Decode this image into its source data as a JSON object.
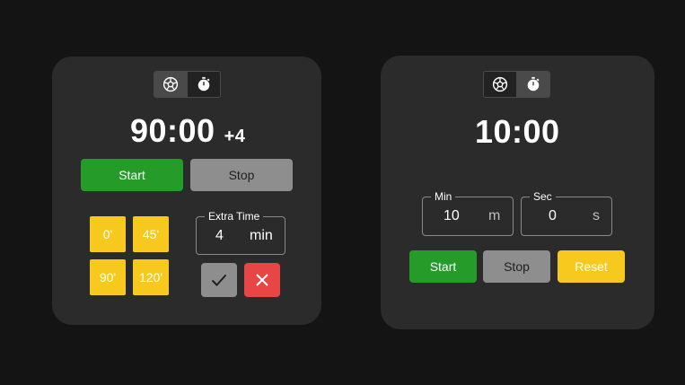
{
  "match": {
    "modes": [
      {
        "icon": "soccer-ball-icon",
        "active": true
      },
      {
        "icon": "stopwatch-icon",
        "active": false
      }
    ],
    "clock": "90:00",
    "added_time": "+4",
    "start_label": "Start",
    "stop_label": "Stop",
    "quick_minutes": [
      "0'",
      "45'",
      "90'",
      "120'"
    ],
    "extra_time": {
      "legend": "Extra Time",
      "value": "4",
      "unit": "min"
    }
  },
  "timer": {
    "modes": [
      {
        "icon": "soccer-ball-icon",
        "active": false
      },
      {
        "icon": "stopwatch-icon",
        "active": true
      }
    ],
    "clock": "10:00",
    "min_field": {
      "legend": "Min",
      "value": "10",
      "unit": "m"
    },
    "sec_field": {
      "legend": "Sec",
      "value": "0",
      "unit": "s"
    },
    "start_label": "Start",
    "stop_label": "Stop",
    "reset_label": "Reset"
  },
  "colors": {
    "green": "#259b2a",
    "grey": "#8e8e8e",
    "yellow": "#f7c91f",
    "red": "#e84545",
    "card": "#2b2b2b",
    "background": "#141414"
  }
}
